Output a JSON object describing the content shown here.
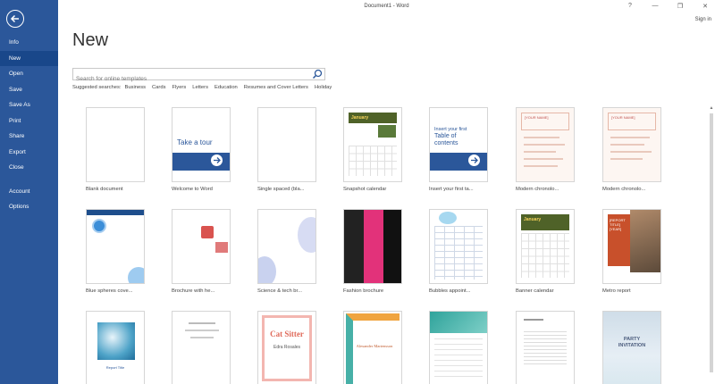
{
  "window": {
    "title": "Document1 - Word",
    "help": "?",
    "minimize": "—",
    "restore": "❐",
    "close": "✕",
    "sign_in": "Sign in"
  },
  "sidebar": {
    "items": [
      {
        "label": "Info"
      },
      {
        "label": "New"
      },
      {
        "label": "Open"
      },
      {
        "label": "Save"
      },
      {
        "label": "Save As"
      },
      {
        "label": "Print"
      },
      {
        "label": "Share"
      },
      {
        "label": "Export"
      },
      {
        "label": "Close"
      },
      {
        "label": "Account"
      },
      {
        "label": "Options"
      }
    ]
  },
  "main": {
    "title": "New",
    "search_placeholder": "Search for online templates",
    "suggested_label": "Suggested searches:",
    "suggested": [
      "Business",
      "Cards",
      "Flyers",
      "Letters",
      "Education",
      "Resumes and Cover Letters",
      "Holiday"
    ]
  },
  "templates": [
    {
      "label": "Blank document"
    },
    {
      "label": "Welcome to Word",
      "thumb_text": "Take a tour"
    },
    {
      "label": "Single spaced (bla..."
    },
    {
      "label": "Snapshot calendar",
      "thumb_text": "January"
    },
    {
      "label": "Insert your first ta...",
      "thumb_text_1": "Insert your first",
      "thumb_text_2": "Table of",
      "thumb_text_3": "contents"
    },
    {
      "label": "Modern chronolo...",
      "thumb_text": "[YOUR NAME]"
    },
    {
      "label": "Modern chronolo...",
      "thumb_text": "[YOUR NAME]"
    },
    {
      "label": "Blue spheres cove..."
    },
    {
      "label": "Brochure with he..."
    },
    {
      "label": "Science & tech br..."
    },
    {
      "label": "Fashion brochure"
    },
    {
      "label": "Bubbles appoint..."
    },
    {
      "label": "Banner calendar",
      "thumb_text": "January"
    },
    {
      "label": "Metro report",
      "thumb_text": "[REPORT TITLE] [YEAR]"
    },
    {
      "label": "",
      "thumb_text": "Report Title"
    },
    {
      "label": ""
    },
    {
      "label": "",
      "thumb_text_1": "Cat Sitter",
      "thumb_text_2": "Edra Rosales"
    },
    {
      "label": "",
      "thumb_text": "Alexander Martensson"
    },
    {
      "label": ""
    },
    {
      "label": ""
    },
    {
      "label": "",
      "thumb_text_1": "PARTY",
      "thumb_text_2": "INVITATION"
    }
  ]
}
